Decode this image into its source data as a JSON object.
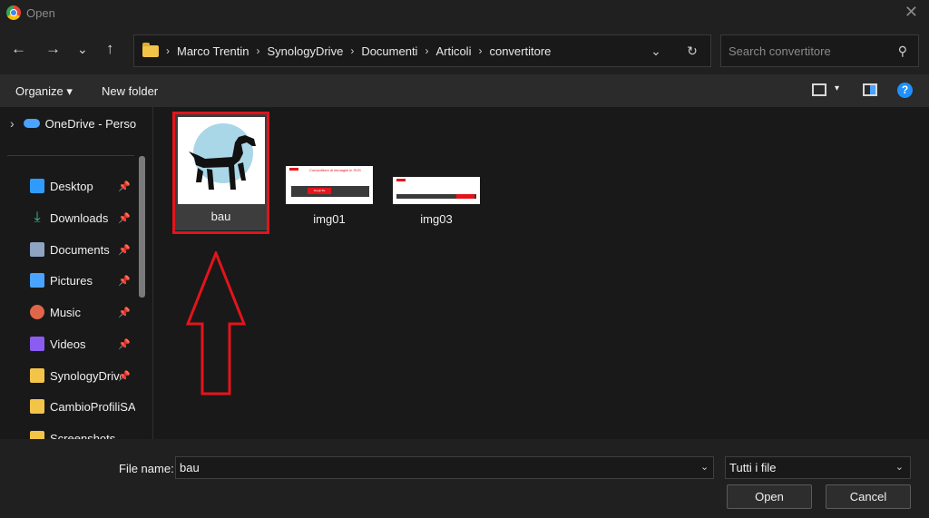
{
  "window": {
    "title": "Open"
  },
  "nav": {
    "back": "←",
    "forward": "→",
    "recent": "⌄",
    "up": "↑",
    "breadcrumbs": [
      "Marco Trentin",
      "SynologyDrive",
      "Documenti",
      "Articoli",
      "convertitore"
    ],
    "separator": "›",
    "history_dropdown": "⌄",
    "refresh": "↻"
  },
  "search": {
    "placeholder": "Search convertitore",
    "icon": "search-icon"
  },
  "toolbar": {
    "organize": "Organize ▾",
    "new_folder": "New folder",
    "help": "?"
  },
  "sidebar": {
    "onedrive": {
      "label": "OneDrive - Perso",
      "icon": "cloud-icon",
      "expand": "›"
    },
    "items": [
      {
        "label": "Desktop",
        "icon": "desktop-icon",
        "pinned": true,
        "color": "#2f9bff"
      },
      {
        "label": "Downloads",
        "icon": "download-icon",
        "pinned": true,
        "color": "#34c48a"
      },
      {
        "label": "Documents",
        "icon": "document-icon",
        "pinned": true,
        "color": "#8fa3c2"
      },
      {
        "label": "Pictures",
        "icon": "pictures-icon",
        "pinned": true,
        "color": "#4aa3ff"
      },
      {
        "label": "Music",
        "icon": "music-icon",
        "pinned": true,
        "color": "#e0664a"
      },
      {
        "label": "Videos",
        "icon": "videos-icon",
        "pinned": true,
        "color": "#8a5cf0"
      },
      {
        "label": "SynologyDrive",
        "icon": "folder-icon",
        "pinned": true,
        "color": "#f2c447"
      },
      {
        "label": "CambioProfiliSA",
        "icon": "folder-icon",
        "pinned": false,
        "color": "#f2c447"
      },
      {
        "label": "Screenshots",
        "icon": "folder-icon",
        "pinned": false,
        "color": "#f2c447"
      }
    ],
    "pin_glyph": "📌"
  },
  "files": [
    {
      "name": "bau",
      "selected": true
    },
    {
      "name": "img01",
      "selected": false
    },
    {
      "name": "img03",
      "selected": false
    }
  ],
  "img01_thumb": {
    "heading": "Convertitore di immagini in SVG",
    "button": "Scegli file"
  },
  "bottom": {
    "file_name_label": "File name:",
    "file_name_value": "bau",
    "file_type": "Tutti i file",
    "open": "Open",
    "cancel": "Cancel"
  },
  "colors": {
    "highlight": "#e3141b",
    "accent": "#1e90ff"
  }
}
